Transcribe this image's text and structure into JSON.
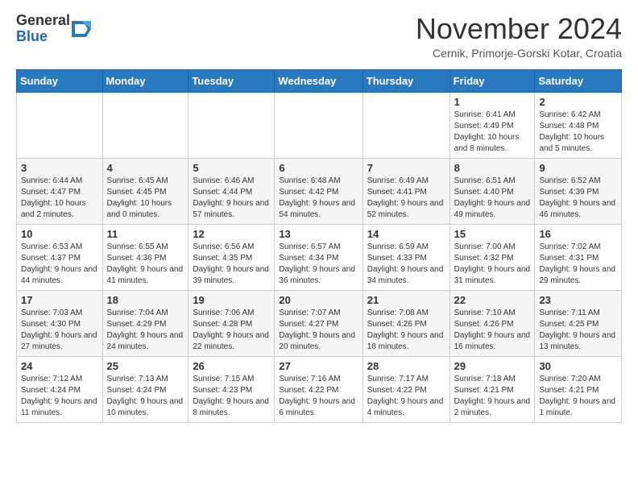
{
  "header": {
    "logo": {
      "general": "General",
      "blue": "Blue"
    },
    "title": "November 2024",
    "subtitle": "Cernik, Primorje-Gorski Kotar, Croatia"
  },
  "weekdays": [
    "Sunday",
    "Monday",
    "Tuesday",
    "Wednesday",
    "Thursday",
    "Friday",
    "Saturday"
  ],
  "weeks": [
    [
      {
        "day": "",
        "info": ""
      },
      {
        "day": "",
        "info": ""
      },
      {
        "day": "",
        "info": ""
      },
      {
        "day": "",
        "info": ""
      },
      {
        "day": "",
        "info": ""
      },
      {
        "day": "1",
        "info": "Sunrise: 6:41 AM\nSunset: 4:49 PM\nDaylight: 10 hours and 8 minutes."
      },
      {
        "day": "2",
        "info": "Sunrise: 6:42 AM\nSunset: 4:48 PM\nDaylight: 10 hours and 5 minutes."
      }
    ],
    [
      {
        "day": "3",
        "info": "Sunrise: 6:44 AM\nSunset: 4:47 PM\nDaylight: 10 hours and 2 minutes."
      },
      {
        "day": "4",
        "info": "Sunrise: 6:45 AM\nSunset: 4:45 PM\nDaylight: 10 hours and 0 minutes."
      },
      {
        "day": "5",
        "info": "Sunrise: 6:46 AM\nSunset: 4:44 PM\nDaylight: 9 hours and 57 minutes."
      },
      {
        "day": "6",
        "info": "Sunrise: 6:48 AM\nSunset: 4:42 PM\nDaylight: 9 hours and 54 minutes."
      },
      {
        "day": "7",
        "info": "Sunrise: 6:49 AM\nSunset: 4:41 PM\nDaylight: 9 hours and 52 minutes."
      },
      {
        "day": "8",
        "info": "Sunrise: 6:51 AM\nSunset: 4:40 PM\nDaylight: 9 hours and 49 minutes."
      },
      {
        "day": "9",
        "info": "Sunrise: 6:52 AM\nSunset: 4:39 PM\nDaylight: 9 hours and 46 minutes."
      }
    ],
    [
      {
        "day": "10",
        "info": "Sunrise: 6:53 AM\nSunset: 4:37 PM\nDaylight: 9 hours and 44 minutes."
      },
      {
        "day": "11",
        "info": "Sunrise: 6:55 AM\nSunset: 4:36 PM\nDaylight: 9 hours and 41 minutes."
      },
      {
        "day": "12",
        "info": "Sunrise: 6:56 AM\nSunset: 4:35 PM\nDaylight: 9 hours and 39 minutes."
      },
      {
        "day": "13",
        "info": "Sunrise: 6:57 AM\nSunset: 4:34 PM\nDaylight: 9 hours and 36 minutes."
      },
      {
        "day": "14",
        "info": "Sunrise: 6:59 AM\nSunset: 4:33 PM\nDaylight: 9 hours and 34 minutes."
      },
      {
        "day": "15",
        "info": "Sunrise: 7:00 AM\nSunset: 4:32 PM\nDaylight: 9 hours and 31 minutes."
      },
      {
        "day": "16",
        "info": "Sunrise: 7:02 AM\nSunset: 4:31 PM\nDaylight: 9 hours and 29 minutes."
      }
    ],
    [
      {
        "day": "17",
        "info": "Sunrise: 7:03 AM\nSunset: 4:30 PM\nDaylight: 9 hours and 27 minutes."
      },
      {
        "day": "18",
        "info": "Sunrise: 7:04 AM\nSunset: 4:29 PM\nDaylight: 9 hours and 24 minutes."
      },
      {
        "day": "19",
        "info": "Sunrise: 7:06 AM\nSunset: 4:28 PM\nDaylight: 9 hours and 22 minutes."
      },
      {
        "day": "20",
        "info": "Sunrise: 7:07 AM\nSunset: 4:27 PM\nDaylight: 9 hours and 20 minutes."
      },
      {
        "day": "21",
        "info": "Sunrise: 7:08 AM\nSunset: 4:26 PM\nDaylight: 9 hours and 18 minutes."
      },
      {
        "day": "22",
        "info": "Sunrise: 7:10 AM\nSunset: 4:26 PM\nDaylight: 9 hours and 16 minutes."
      },
      {
        "day": "23",
        "info": "Sunrise: 7:11 AM\nSunset: 4:25 PM\nDaylight: 9 hours and 13 minutes."
      }
    ],
    [
      {
        "day": "24",
        "info": "Sunrise: 7:12 AM\nSunset: 4:24 PM\nDaylight: 9 hours and 11 minutes."
      },
      {
        "day": "25",
        "info": "Sunrise: 7:13 AM\nSunset: 4:24 PM\nDaylight: 9 hours and 10 minutes."
      },
      {
        "day": "26",
        "info": "Sunrise: 7:15 AM\nSunset: 4:23 PM\nDaylight: 9 hours and 8 minutes."
      },
      {
        "day": "27",
        "info": "Sunrise: 7:16 AM\nSunset: 4:22 PM\nDaylight: 9 hours and 6 minutes."
      },
      {
        "day": "28",
        "info": "Sunrise: 7:17 AM\nSunset: 4:22 PM\nDaylight: 9 hours and 4 minutes."
      },
      {
        "day": "29",
        "info": "Sunrise: 7:18 AM\nSunset: 4:21 PM\nDaylight: 9 hours and 2 minutes."
      },
      {
        "day": "30",
        "info": "Sunrise: 7:20 AM\nSunset: 4:21 PM\nDaylight: 9 hours and 1 minute."
      }
    ]
  ]
}
